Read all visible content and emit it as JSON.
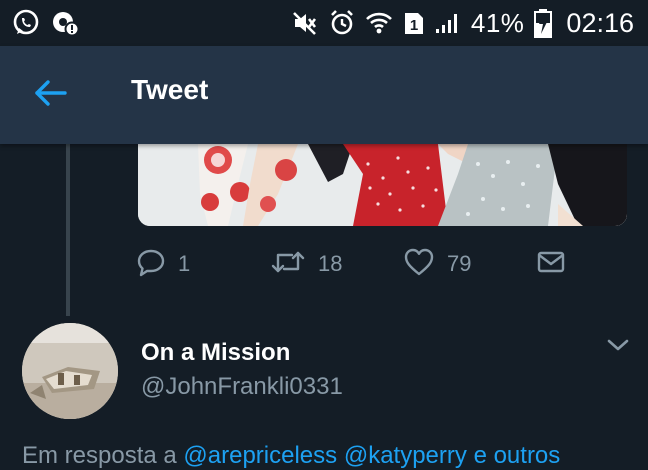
{
  "status_bar": {
    "icons_left": [
      "whatsapp-icon",
      "notification-settings-icon"
    ],
    "icons_right": [
      "mute-icon",
      "alarm-icon",
      "wifi-icon",
      "sim-1-icon",
      "signal-icon",
      "battery-icon"
    ],
    "sim_label": "1",
    "battery_percent": "41%",
    "time": "02:16"
  },
  "app_bar": {
    "title": "Tweet",
    "back_icon": "back-arrow-icon"
  },
  "tweet_actions": {
    "reply_count": "1",
    "retweet_count": "18",
    "like_count": "79",
    "icons": [
      "reply-icon",
      "retweet-icon",
      "like-icon",
      "message-icon"
    ]
  },
  "reply_tweet": {
    "display_name": "On a Mission",
    "handle": "@JohnFrankli0331",
    "reply_prefix": "Em resposta a",
    "mentions": [
      "@arepriceless",
      "@katyperry"
    ],
    "reply_suffix": "e outros"
  },
  "colors": {
    "background": "#141d26",
    "app_bar": "#243447",
    "accent": "#1da1f2",
    "secondary_text": "#8899a6"
  }
}
